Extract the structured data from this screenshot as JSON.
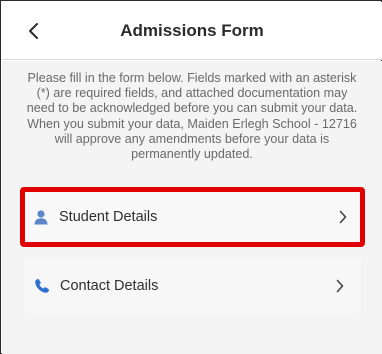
{
  "header": {
    "title": "Admissions Form",
    "back_icon": "chevron-left-icon"
  },
  "intro": {
    "text": "Please fill in the form below. Fields marked with an asterisk (*) are required fields, and attached documentation may need to be acknowledged before you can submit your data. When you submit your data, Maiden Erlegh School - 12716 will approve any amendments before your data is permanently updated."
  },
  "sections": [
    {
      "label": "Student Details",
      "icon": "person-icon",
      "highlighted": true
    },
    {
      "label": "Contact Details",
      "icon": "phone-icon",
      "highlighted": false
    }
  ],
  "colors": {
    "accent": "#2f6fcf",
    "highlight": "#e00000"
  }
}
